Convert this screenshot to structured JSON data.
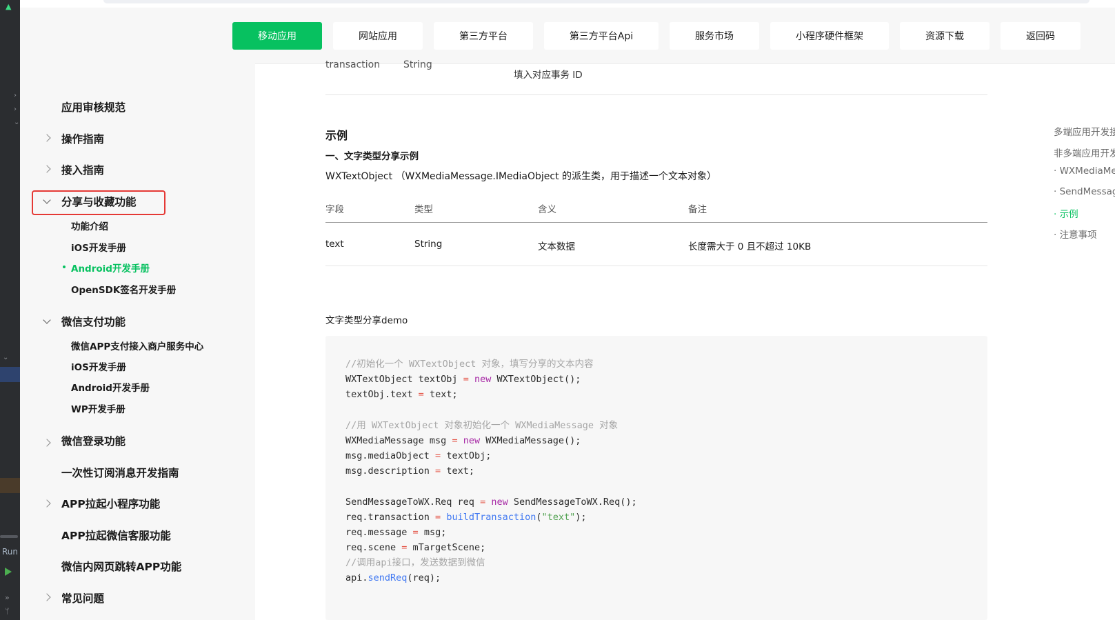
{
  "ide": {
    "run_label": "Run"
  },
  "nav": {
    "items": [
      "移动应用",
      "网站应用",
      "第三方平台",
      "第三方平台Api",
      "服务市场",
      "小程序硬件框架",
      "资源下载",
      "返回码"
    ],
    "active_index": 0,
    "accent_color": "#07c160"
  },
  "sidebar": {
    "items": [
      {
        "label": "应用审核规范"
      },
      {
        "label": "操作指南"
      },
      {
        "label": "接入指南"
      },
      {
        "label": "分享与收藏功能",
        "expanded": true,
        "highlighted": true,
        "children": [
          "功能介绍",
          "iOS开发手册",
          "Android开发手册",
          "OpenSDK签名开发手册"
        ],
        "active_child": 2
      },
      {
        "label": "微信支付功能",
        "expanded": true,
        "children": [
          "微信APP支付接入商户服务中心",
          "iOS开发手册",
          "Android开发手册",
          "WP开发手册"
        ]
      },
      {
        "label": "微信登录功能"
      },
      {
        "label": "一次性订阅消息开发指南"
      },
      {
        "label": "APP拉起小程序功能"
      },
      {
        "label": "APP拉起微信客服功能"
      },
      {
        "label": "微信内网页跳转APP功能"
      },
      {
        "label": "常见问题"
      }
    ]
  },
  "main": {
    "prev_row": {
      "field": "transaction",
      "type": "String",
      "note": "填入对应事务 ID"
    },
    "section_title": "示例",
    "subsection_title": "一、文字类型分享示例",
    "description": "WXTextObject （WXMediaMessage.IMediaObject 的派生类，用于描述一个文本对象）",
    "table": {
      "headers": [
        "字段",
        "类型",
        "含义",
        "备注"
      ],
      "rows": [
        [
          "text",
          "String",
          "文本数据",
          "长度需大于 0 且不超过 10KB"
        ]
      ]
    },
    "demo_title": "文字类型分享demo",
    "code": {
      "c1": "//初始化一个 WXTextObject 对象，填写分享的文本内容",
      "c2": "//用 WXTextObject 对象初始化一个 WXMediaMessage 对象",
      "c3": "//调用api接口，发送数据到微信"
    }
  },
  "toc": {
    "items": [
      "多端应用开发接入",
      "非多端应用开发",
      "· WXMediaMessage",
      "· SendMessageToWX",
      "· 示例",
      "· 注意事项"
    ],
    "active_index": 4
  }
}
